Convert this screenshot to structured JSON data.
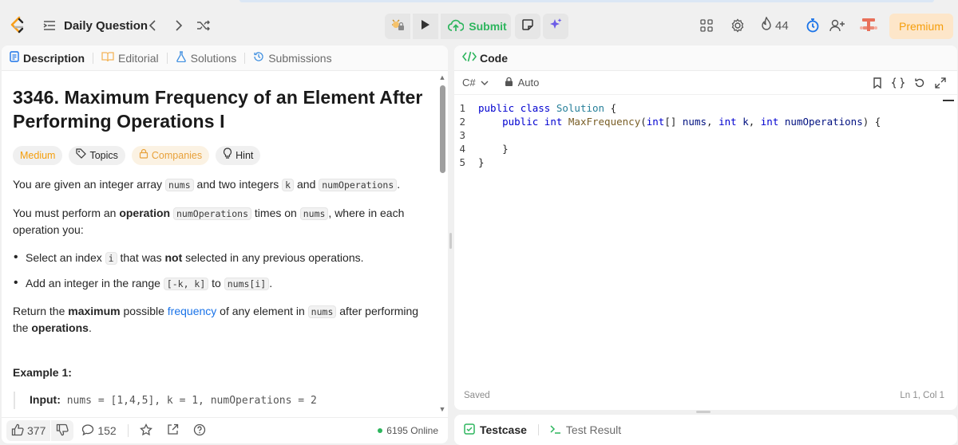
{
  "colors": {
    "accent_green": "#2db55d",
    "medium": "#f59e0b",
    "link": "#1a73e8",
    "premium_bg": "#fde6c9",
    "premium_text": "#f59e0b",
    "keyword": "#0000d0"
  },
  "header": {
    "daily_label": "Daily Question",
    "submit_label": "Submit",
    "streak_count": "44",
    "premium_label": "Premium",
    "icons": [
      "leetcode-logo-icon",
      "list-icon",
      "chevron-left-icon",
      "chevron-right-icon",
      "shuffle-icon",
      "debug-icon",
      "play-icon",
      "cloud-upload-icon",
      "note-icon",
      "sparkle-icon",
      "layout-icon",
      "gear-icon",
      "flame-icon",
      "timer-icon",
      "add-user-icon",
      "brand-icon"
    ]
  },
  "left_tabs": [
    {
      "label": "Description",
      "icon": "document-icon"
    },
    {
      "label": "Editorial",
      "icon": "book-icon"
    },
    {
      "label": "Solutions",
      "icon": "flask-icon"
    },
    {
      "label": "Submissions",
      "icon": "history-icon"
    }
  ],
  "problem": {
    "title": "3346. Maximum Frequency of an Element After Performing Operations I",
    "chips": {
      "difficulty": "Medium",
      "topics": "Topics",
      "companies": "Companies",
      "hint": "Hint"
    },
    "p1": {
      "t1": "You are given an integer array ",
      "c1": "nums",
      "t2": " and two integers ",
      "c2": "k",
      "t3": " and ",
      "c3": "numOperations",
      "t4": "."
    },
    "p2": {
      "t1": "You must perform an ",
      "b1": "operation",
      "t2": " ",
      "c1": "numOperations",
      "t3": " times on ",
      "c2": "nums",
      "t4": ", where in each operation you:"
    },
    "bullet1": {
      "t1": "Select an index ",
      "c1": "i",
      "t2": " that was ",
      "b1": "not",
      "t3": " selected in any previous operations."
    },
    "bullet2": {
      "t1": "Add an integer in the range ",
      "c1": "[-k, k]",
      "t2": " to ",
      "c2": "nums[i]",
      "t3": "."
    },
    "p3": {
      "t1": "Return the ",
      "b1": "maximum",
      "t2": " possible ",
      "link": "frequency",
      "t3": " of any element in ",
      "c1": "nums",
      "t4": " after performing the ",
      "b2": "operations",
      "t5": "."
    },
    "example_title": "Example 1:",
    "example_input_label": "Input:",
    "example_input_value": " nums = [1,4,5], k = 1, numOperations = 2"
  },
  "footer": {
    "likes": "377",
    "comments": "152",
    "online": "6195 Online"
  },
  "code_panel": {
    "title": "Code",
    "language": "C#",
    "mode": "Auto",
    "saved": "Saved",
    "position": "Ln 1, Col 1",
    "lines": {
      "1": {
        "n": "1",
        "a": "public",
        "b": " ",
        "c": "class",
        "d": " ",
        "e": "Solution",
        "f": " {"
      },
      "2": {
        "n": "2",
        "indent": "    ",
        "a": "public",
        "b": " ",
        "c": "int",
        "d": " ",
        "e": "MaxFrequency",
        "f": "(",
        "g": "int",
        "h": "[] ",
        "i": "nums",
        "j": ", ",
        "k": "int",
        "l": " ",
        "m": "k",
        "o": ", ",
        "p": "int",
        "q": " ",
        "r": "numOperations",
        "s": ") {"
      },
      "3": {
        "n": "3"
      },
      "4": {
        "n": "4",
        "text": "    }"
      },
      "5": {
        "n": "5",
        "text": "}"
      }
    }
  },
  "bottom_tabs": [
    {
      "label": "Testcase",
      "icon": "checkbox-icon"
    },
    {
      "label": "Test Result",
      "icon": "terminal-icon"
    }
  ]
}
